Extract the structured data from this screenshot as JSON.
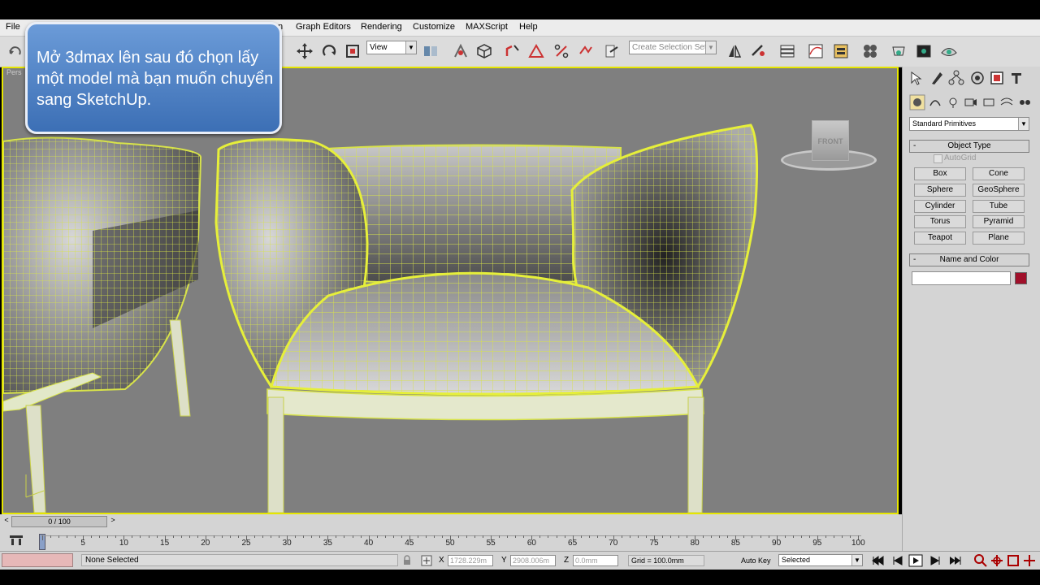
{
  "menu": [
    "File",
    "Graph Editors",
    "Rendering",
    "Customize",
    "MAXScript",
    "Help",
    "n"
  ],
  "toolbar": {
    "view_combo": "View",
    "selection_set_placeholder": "Create Selection Set"
  },
  "callout": {
    "text": "Mở 3dmax lên sau đó chọn lấy một model mà bạn muốn chuyển sang SketchUp."
  },
  "viewport": {
    "label": "Pers",
    "viewcube_label": "FRONT"
  },
  "command_panel": {
    "category": "Standard Primitives",
    "object_type_title": "Object Type",
    "autogrid_label": "AutoGrid",
    "primitives": [
      "Box",
      "Cone",
      "Sphere",
      "GeoSphere",
      "Cylinder",
      "Tube",
      "Torus",
      "Pyramid",
      "Teapot",
      "Plane"
    ],
    "name_color_title": "Name and Color",
    "object_color": "#a0102a"
  },
  "timeline": {
    "frame_display": "0 / 100",
    "ticks": [
      "5",
      "10",
      "15",
      "20",
      "25",
      "30",
      "35",
      "40",
      "45",
      "50",
      "55",
      "60",
      "65",
      "70",
      "75",
      "80",
      "85",
      "90",
      "95",
      "100"
    ]
  },
  "status": {
    "selection": "None Selected",
    "x_label": "X",
    "x_value": "1728.229m",
    "y_label": "Y",
    "y_value": "2908.006m",
    "z_label": "Z",
    "z_value": "0.0mm",
    "grid": "Grid = 100.0mm",
    "auto_key": "Auto Key",
    "key_mode": "Selected"
  },
  "colors": {
    "accent": "#e6e600",
    "wire": "#d8e34a",
    "callout": "#4a7fc4"
  }
}
